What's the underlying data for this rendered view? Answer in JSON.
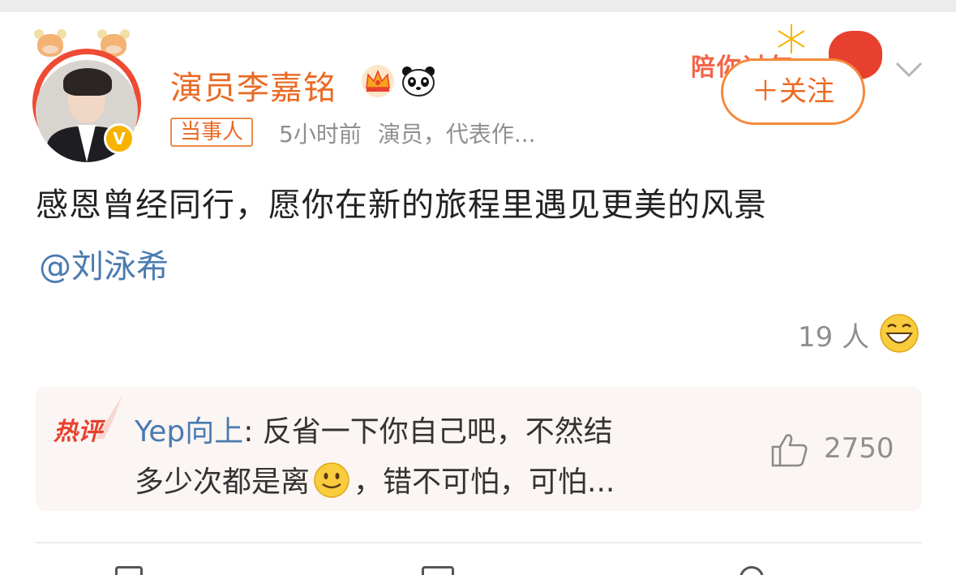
{
  "post": {
    "author_name": "演员李嘉铭",
    "author_tag": "当事人",
    "time": "5小时前",
    "author_desc": "演员，代表作...",
    "follow_label": "＋关注",
    "decoration_text": "陪你过年",
    "content": "感恩曾经同行，愿你在新的旅程里遇见更美的风景",
    "mention": "@刘泳希",
    "reaction_count": "19 人"
  },
  "hot_comment": {
    "badge": "热评",
    "user": "Yep向上",
    "separator": ": ",
    "text_line1": "反省一下你自己吧，不然结",
    "text_line2a": "多少次都是离",
    "text_line2b": "，错不可怕，可怕...",
    "likes": "2750"
  },
  "icons": {
    "verified": "V",
    "crown": "crown-icon",
    "panda": "panda-icon",
    "grin": "grin-emoji-icon",
    "smile": "smile-emoji-icon",
    "like": "thumbs-up-icon",
    "more": "chevron-down-icon"
  },
  "colors": {
    "accent_orange": "#ea6a24",
    "link_blue": "#4a7bb0",
    "hot_red": "#e8402e",
    "muted_gray": "#8f8f8f"
  }
}
